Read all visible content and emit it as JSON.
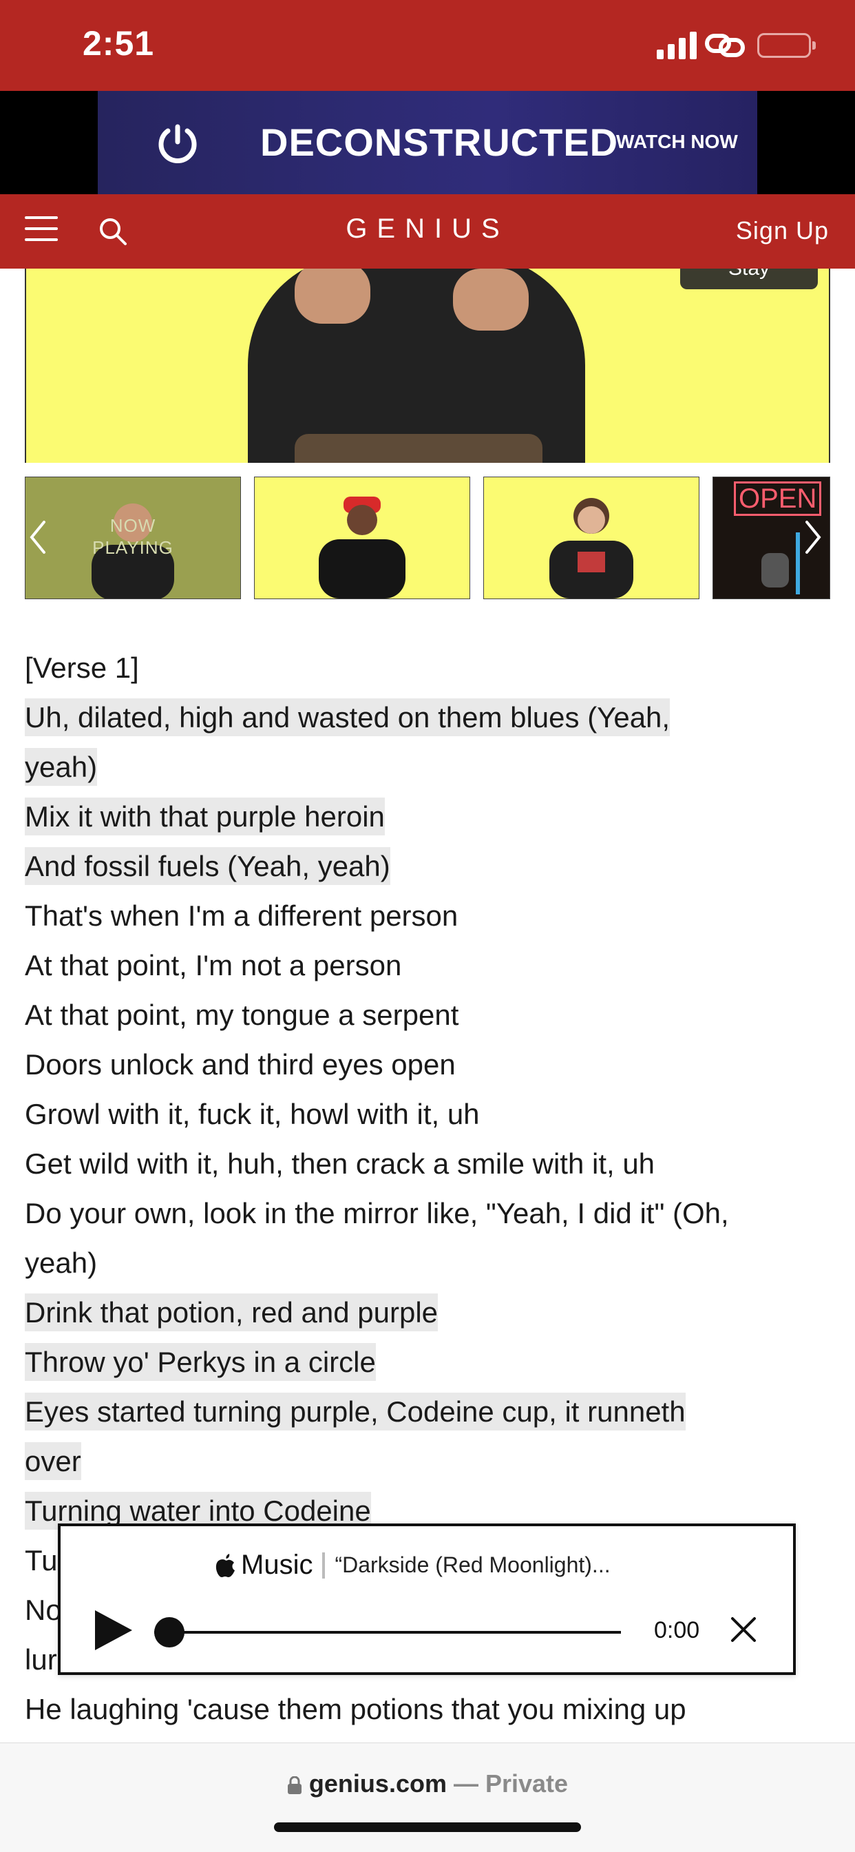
{
  "status_bar": {
    "time": "2:51"
  },
  "ad": {
    "title": "DECONSTRUCTED",
    "cta": "WATCH NOW"
  },
  "nav": {
    "brand": "GENIUS",
    "signup": "Sign Up"
  },
  "video": {
    "overlay_label": "Stay"
  },
  "thumbnails": {
    "now_playing_line1": "NOW",
    "now_playing_line2": "PLAYING",
    "sign_text": "OPEN"
  },
  "lyrics": {
    "lines": [
      {
        "text": "[Verse 1]",
        "highlighted": false
      },
      {
        "text": "Uh, dilated, high and wasted on them blues (Yeah,",
        "highlighted": true
      },
      {
        "text": "yeah)",
        "highlighted": true
      },
      {
        "text": "Mix it with that purple heroin",
        "highlighted": true
      },
      {
        "text": "And fossil fuels (Yeah, yeah)",
        "highlighted": true
      },
      {
        "text": "That's when I'm a different person",
        "highlighted": false
      },
      {
        "text": "At that point, I'm not a person",
        "highlighted": false
      },
      {
        "text": "At that point, my tongue a serpent",
        "highlighted": false
      },
      {
        "text": "Doors unlock and third eyes open",
        "highlighted": false
      },
      {
        "text": "Growl with it, fuck it, howl with it, uh",
        "highlighted": false
      },
      {
        "text": "Get wild with it, huh, then crack a smile with it, uh",
        "highlighted": false
      },
      {
        "text": "Do your own, look in the mirror like, \"Yeah, I did it\" (Oh,",
        "highlighted": false
      },
      {
        "text": "yeah)",
        "highlighted": false
      },
      {
        "text": "Drink that potion, red and purple",
        "highlighted": true
      },
      {
        "text": "Throw yo' Perkys in a circle",
        "highlighted": true
      },
      {
        "text": "Eyes started turning purple, Codeine cup, it runneth",
        "highlighted": true
      },
      {
        "text": "over",
        "highlighted": true
      },
      {
        "text": "Turning water into Codeine",
        "highlighted": true
      },
      {
        "text": "Tu",
        "highlighted": false
      },
      {
        "text": "No",
        "highlighted": false
      },
      {
        "text": "lur",
        "highlighted": false
      },
      {
        "text": "He laughing 'cause them potions that you mixing up",
        "highlighted": false
      }
    ]
  },
  "player": {
    "service": "Music",
    "song": "“Darkside (Red Moonlight)...",
    "time": "0:00",
    "progress": 0
  },
  "url_bar": {
    "domain": "genius.com",
    "separator": " — ",
    "mode": "Private"
  },
  "colors": {
    "genius_red": "#b42722",
    "video_yellow": "#fbfb72",
    "highlight": "#e9e9e9"
  }
}
